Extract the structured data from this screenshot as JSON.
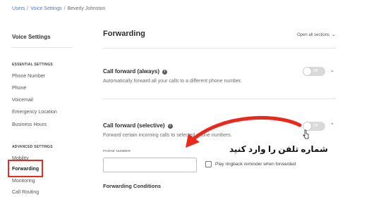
{
  "breadcrumb": {
    "users": "Users",
    "sep": "/",
    "voice_settings": "Voice Settings",
    "user": "Beverly Johnston"
  },
  "sidebar": {
    "title": "Voice Settings",
    "essential_header": "ESSENTIAL SETTINGS",
    "essential_items": [
      "Phone Number",
      "Phone",
      "Voicemail",
      "Emergency Location",
      "Business Hours"
    ],
    "advanced_header": "ADVANCED SETTINGS",
    "advanced_items": [
      "Mobility",
      "Forwarding",
      "Monitoring",
      "Call Routing"
    ],
    "active_item": "Forwarding"
  },
  "main": {
    "title": "Forwarding",
    "open_all": "Open all sections",
    "sections": [
      {
        "title": "Call forward (always)",
        "description": "Automatically forward all your calls to a different phone number.",
        "toggle_label": "Off",
        "enabled": false
      },
      {
        "title": "Call forward (selective)",
        "description": "Forward certain incoming calls to selected phone numbers.",
        "toggle_label": "Off",
        "enabled": false
      }
    ],
    "phone_number_label": "PHONE NUMBER",
    "phone_number_value": "",
    "ringback_label": "Play ringback reminder when forwarded",
    "ringback_checked": false,
    "conditions_title": "Forwarding Conditions"
  },
  "annotation": {
    "text": "شماره تلفن را وارد کنید",
    "color": "#e8291c"
  },
  "colors": {
    "link": "#4a7cc9",
    "highlight": "#e8291c",
    "toggle_off": "#d9d9d9"
  }
}
